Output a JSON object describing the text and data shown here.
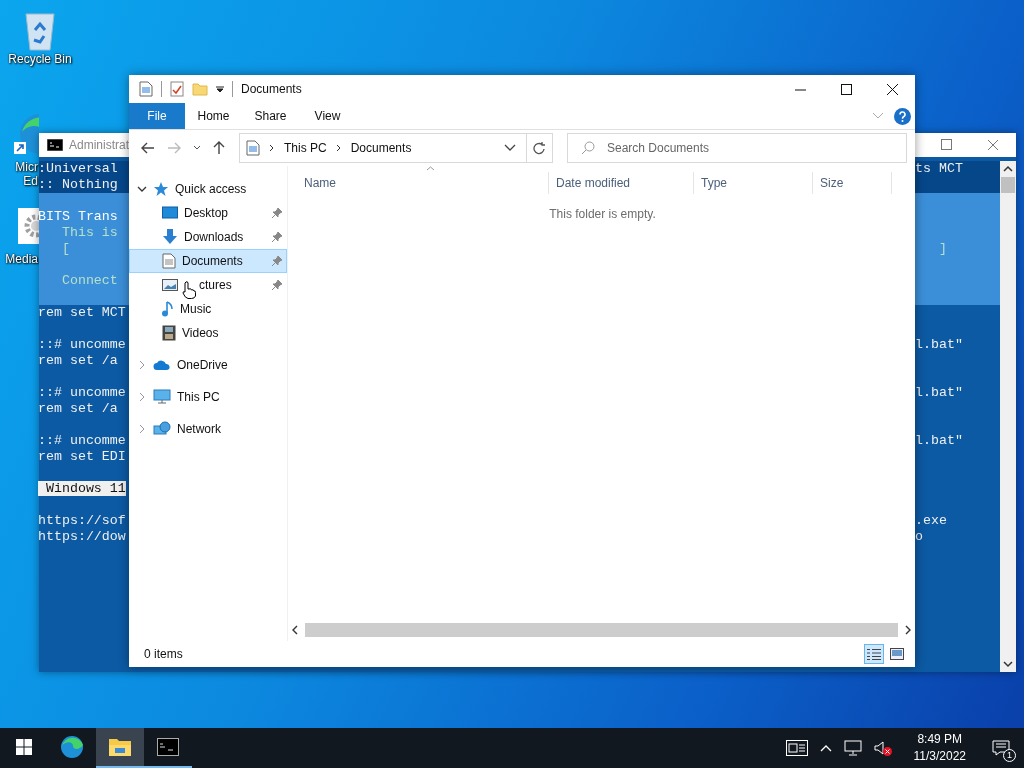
{
  "desktop_icons": [
    {
      "kind": "recycle_bin",
      "lines": [
        "Recycle Bin"
      ]
    },
    {
      "kind": "edge",
      "lines": [
        "Micr",
        "Ed"
      ]
    },
    {
      "kind": "settings",
      "lines": [
        "Media"
      ]
    }
  ],
  "console": {
    "title": "Administrat",
    "lines": [
      {
        "kind": "header",
        "left": ":Universal",
        "right": "ts MCT"
      },
      {
        "kind": "header",
        "left": ":: Nothing"
      },
      {
        "kind": "box"
      },
      {
        "kind": "box",
        "left": "BITS Trans"
      },
      {
        "kind": "box",
        "left": "   This is"
      },
      {
        "kind": "box",
        "left": "   [",
        "right": "   ]"
      },
      {
        "kind": "box"
      },
      {
        "kind": "box",
        "left": "   Connect"
      },
      {
        "kind": "box"
      },
      {
        "kind": "normal",
        "left": "rem set MCT"
      },
      {
        "kind": "normal"
      },
      {
        "kind": "normal",
        "left": "::# uncomme",
        "right": "l.bat\""
      },
      {
        "kind": "normal",
        "left": "rem set /a"
      },
      {
        "kind": "normal"
      },
      {
        "kind": "normal",
        "left": "::# uncomme",
        "right": "l.bat\""
      },
      {
        "kind": "normal",
        "left": "rem set /a"
      },
      {
        "kind": "normal"
      },
      {
        "kind": "normal",
        "left": "::# uncomme",
        "right": "l.bat\""
      },
      {
        "kind": "normal",
        "left": "rem set EDI"
      },
      {
        "kind": "normal"
      },
      {
        "kind": "inverse",
        "left": " Windows 11"
      },
      {
        "kind": "normal"
      },
      {
        "kind": "normal",
        "left": "https://sof",
        "right": ".exe"
      },
      {
        "kind": "normal",
        "left": "https://dow",
        "right": "o"
      }
    ]
  },
  "explorer": {
    "title": "Documents",
    "ribbon_tabs": [
      {
        "label": "File",
        "kind": "file"
      },
      {
        "label": "Home",
        "kind": "tab"
      },
      {
        "label": "Share",
        "kind": "tab"
      },
      {
        "label": "View",
        "kind": "tab"
      }
    ],
    "address": [
      "This PC",
      "Documents"
    ],
    "search": {
      "placeholder": "Search Documents"
    },
    "nav": [
      {
        "label": "Quick access",
        "kind": "star",
        "expanded": true,
        "selected": false,
        "children": [
          {
            "label": "Desktop",
            "kind": "desktop",
            "pinned": true,
            "selected": false,
            "pointer_over": false
          },
          {
            "label": "Downloads",
            "kind": "download",
            "pinned": true,
            "selected": false,
            "pointer_over": false
          },
          {
            "label": "Documents",
            "kind": "document",
            "pinned": true,
            "selected": true,
            "pointer_over": false
          },
          {
            "label": "ctures",
            "kind": "picture",
            "pinned": true,
            "selected": false,
            "pointer_over": true
          },
          {
            "label": "Music",
            "kind": "music",
            "pinned": false,
            "selected": false,
            "pointer_over": false
          },
          {
            "label": "Videos",
            "kind": "video",
            "pinned": false,
            "selected": false,
            "pointer_over": false
          }
        ]
      },
      {
        "label": "OneDrive",
        "kind": "cloud",
        "expanded": false,
        "selected": false
      },
      {
        "label": "This PC",
        "kind": "computer",
        "expanded": false,
        "selected": false
      },
      {
        "label": "Network",
        "kind": "network",
        "expanded": false,
        "selected": false
      }
    ],
    "columns": [
      "Name",
      "Date modified",
      "Type",
      "Size"
    ],
    "empty_message": "This folder is empty.",
    "status": "0 items",
    "view_buttons": [
      {
        "kind": "details",
        "selected": true
      },
      {
        "kind": "tiles",
        "selected": false
      }
    ]
  },
  "taskbar": {
    "apps": [
      {
        "kind": "edge",
        "active": false,
        "running": false
      },
      {
        "kind": "explorer",
        "active": true,
        "running": true
      },
      {
        "kind": "console",
        "active": false,
        "running": true
      }
    ],
    "time": "8:49 PM",
    "date": "11/3/2022",
    "notifications": "1",
    "volume_muted": true
  }
}
